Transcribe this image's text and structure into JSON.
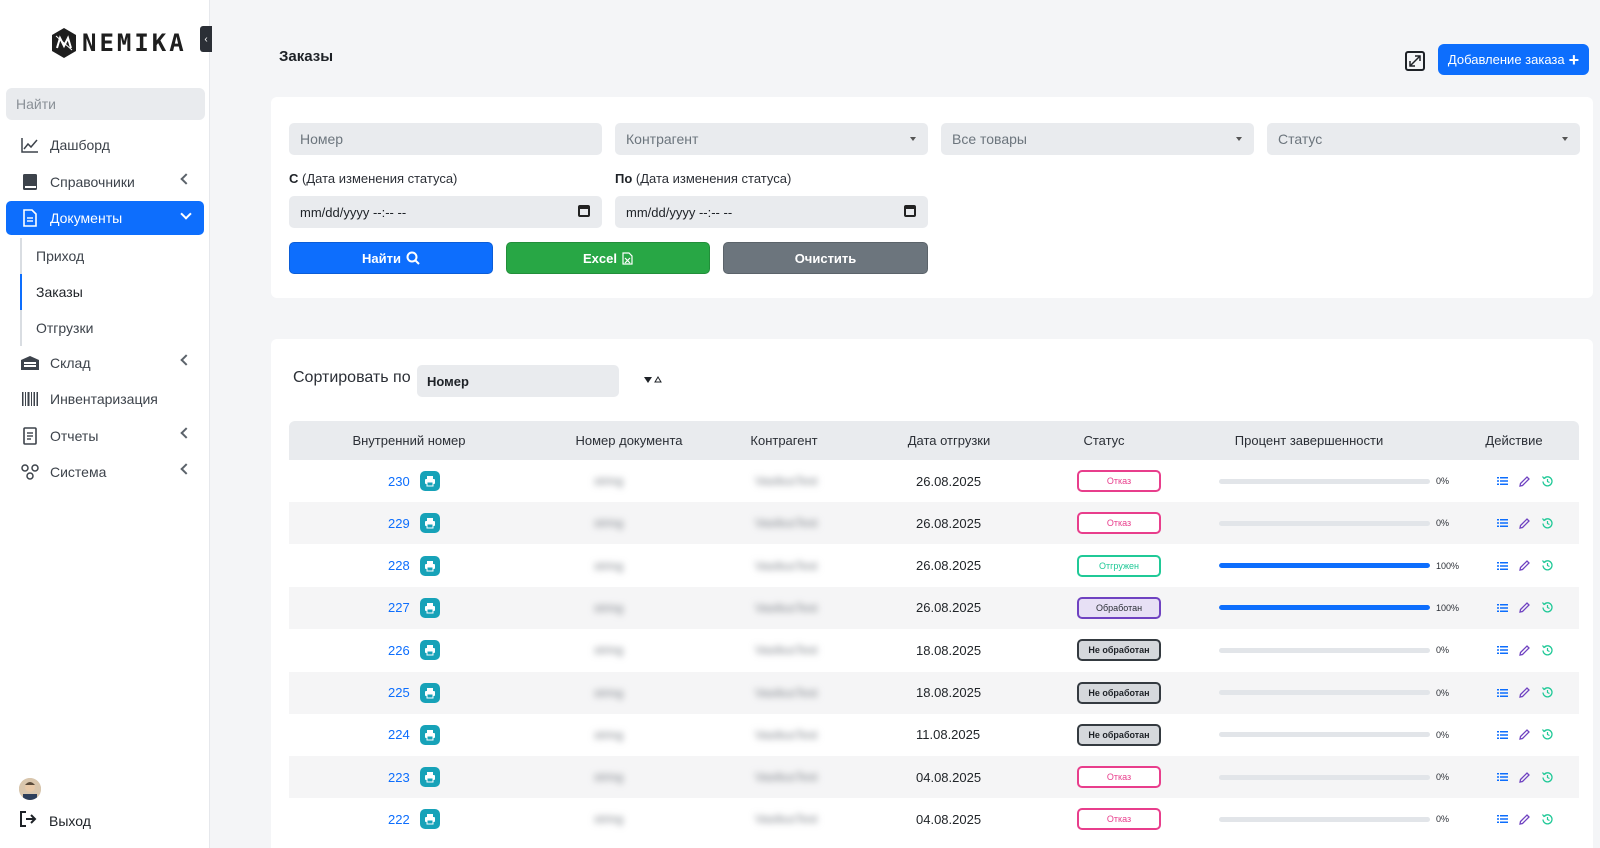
{
  "sidebar": {
    "brand": "NEMIKA",
    "search_placeholder": "Найти",
    "items": [
      {
        "label": "Дашборд"
      },
      {
        "label": "Справочники"
      },
      {
        "label": "Документы"
      },
      {
        "label": "Склад"
      },
      {
        "label": "Инвентаризация"
      },
      {
        "label": "Отчеты"
      },
      {
        "label": "Система"
      }
    ],
    "sub_items": [
      {
        "label": "Приход"
      },
      {
        "label": "Заказы"
      },
      {
        "label": "Отгрузки"
      }
    ],
    "logout_label": "Выход"
  },
  "header": {
    "title": "Заказы",
    "add_button": "Добавление заказа"
  },
  "filters": {
    "number_placeholder": "Номер",
    "contractor_placeholder": "Контрагент",
    "products_value": "Все товары",
    "status_placeholder": "Статус",
    "from_label_bold": "С",
    "from_label_rest": " (Дата изменения статуса)",
    "to_label_bold": "По",
    "to_label_rest": " (Дата изменения статуса)",
    "date_placeholder": "mm/dd/yyyy --:-- --",
    "search_button": "Найти",
    "excel_button": "Excel",
    "clear_button": "Очистить"
  },
  "sort": {
    "label": "Сортировать по",
    "value": "Номер"
  },
  "table": {
    "columns": [
      "Внутренний номер",
      "Номер документа",
      "Контрагент",
      "Дата отгрузки",
      "Статус",
      "Процент завершенности",
      "Действие"
    ],
    "rows": [
      {
        "id": "230",
        "doc": "string",
        "contractor": "VasiliusTest",
        "date": "26.08.2025",
        "status": "Отказ",
        "status_kind": "refuse",
        "progress": 0,
        "progress_label": "0%"
      },
      {
        "id": "229",
        "doc": "string",
        "contractor": "VasiliusTest",
        "date": "26.08.2025",
        "status": "Отказ",
        "status_kind": "refuse",
        "progress": 0,
        "progress_label": "0%"
      },
      {
        "id": "228",
        "doc": "string",
        "contractor": "VasiliusTest",
        "date": "26.08.2025",
        "status": "Отгружен",
        "status_kind": "shipped",
        "progress": 100,
        "progress_label": "100%"
      },
      {
        "id": "227",
        "doc": "string",
        "contractor": "VasiliusTest",
        "date": "26.08.2025",
        "status": "Обработан",
        "status_kind": "processed",
        "progress": 100,
        "progress_label": "100%"
      },
      {
        "id": "226",
        "doc": "string",
        "contractor": "VasiliusTest",
        "date": "18.08.2025",
        "status": "Не обработан",
        "status_kind": "notproc",
        "progress": 0,
        "progress_label": "0%"
      },
      {
        "id": "225",
        "doc": "string",
        "contractor": "VasiliusTest",
        "date": "18.08.2025",
        "status": "Не обработан",
        "status_kind": "notproc",
        "progress": 0,
        "progress_label": "0%"
      },
      {
        "id": "224",
        "doc": "string",
        "contractor": "VasiliusTest",
        "date": "11.08.2025",
        "status": "Не обработан",
        "status_kind": "notproc",
        "progress": 0,
        "progress_label": "0%"
      },
      {
        "id": "223",
        "doc": "string",
        "contractor": "VasiliusTest",
        "date": "04.08.2025",
        "status": "Отказ",
        "status_kind": "refuse",
        "progress": 0,
        "progress_label": "0%"
      },
      {
        "id": "222",
        "doc": "string",
        "contractor": "VasiliusTest",
        "date": "04.08.2025",
        "status": "Отказ",
        "status_kind": "refuse",
        "progress": 0,
        "progress_label": "0%"
      }
    ]
  },
  "colors": {
    "primary": "#0d6efd",
    "success": "#28a745",
    "secondary": "#6c757d",
    "info": "#17a2b8",
    "refuse": "#e83e8c",
    "shipped": "#20c997",
    "processed": "#6f42c1"
  },
  "icons": {
    "nav": [
      "chart-line-icon",
      "book-icon",
      "document-icon",
      "warehouse-icon",
      "barcode-icon",
      "report-icon",
      "system-icon"
    ],
    "row_actions": [
      "list-icon",
      "edit-icon",
      "history-icon"
    ]
  }
}
